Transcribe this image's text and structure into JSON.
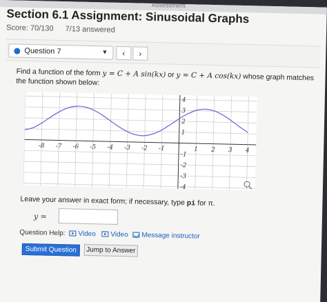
{
  "header": {
    "top_band_text": "Assessment",
    "title": "Section 6.1 Assignment: Sinusoidal Graphs",
    "score": "Score: 70/130",
    "answered": "7/13 answered"
  },
  "question_nav": {
    "selected": "Question 7",
    "prev_symbol": "‹",
    "next_symbol": "›",
    "caret": "▼",
    "accent": "#1c6fd1"
  },
  "prompt": {
    "lead": "Find a function of the form ",
    "form1": "y = C + A sin(kx)",
    "or": " or ",
    "form2": "y = C + A cos(kx)",
    "tail": " whose graph matches the function shown below:"
  },
  "chart_data": {
    "type": "line",
    "x_ticks": [
      "-8",
      "-7",
      "-6",
      "-5",
      "-4",
      "-3",
      "-2",
      "-1",
      "1",
      "2",
      "3",
      "4"
    ],
    "y_ticks": [
      "4",
      "3",
      "2",
      "1",
      "-1",
      "-2",
      "-3",
      "-4"
    ],
    "xlim": [
      -9,
      4.5
    ],
    "ylim": [
      -4.2,
      4.4
    ],
    "grid": true,
    "series": [
      {
        "color": "#6b6fd6",
        "x": [
          -9.0,
          -8.5,
          -8.0,
          -7.5,
          -7.0,
          -6.5,
          -6.0,
          -5.5,
          -5.0,
          -4.5,
          -4.0,
          -3.5,
          -3.0,
          -2.5,
          -2.0,
          -1.5,
          -1.0,
          -0.5,
          0.0,
          0.5,
          1.0,
          1.5,
          2.0,
          2.5,
          3.0,
          3.5,
          4.0
        ],
        "y": [
          0.9,
          1.11,
          1.57,
          2.12,
          2.63,
          3.0,
          3.17,
          3.11,
          2.84,
          2.41,
          1.88,
          1.36,
          0.93,
          0.66,
          0.61,
          0.8,
          1.18,
          1.7,
          2.25,
          2.72,
          3.05,
          3.16,
          3.03,
          2.68,
          2.18,
          1.63,
          1.12
        ]
      }
    ]
  },
  "answer_hint": {
    "lead": "Leave your answer in exact form; if necessary, type ",
    "code": "pi",
    "tail": " for π."
  },
  "answer": {
    "label": "y =",
    "value": ""
  },
  "help": {
    "label": "Question Help:",
    "video1": "Video",
    "video2": "Video",
    "message": "Message instructor"
  },
  "actions": {
    "submit": "Submit Question",
    "jump": "Jump to Answer"
  }
}
